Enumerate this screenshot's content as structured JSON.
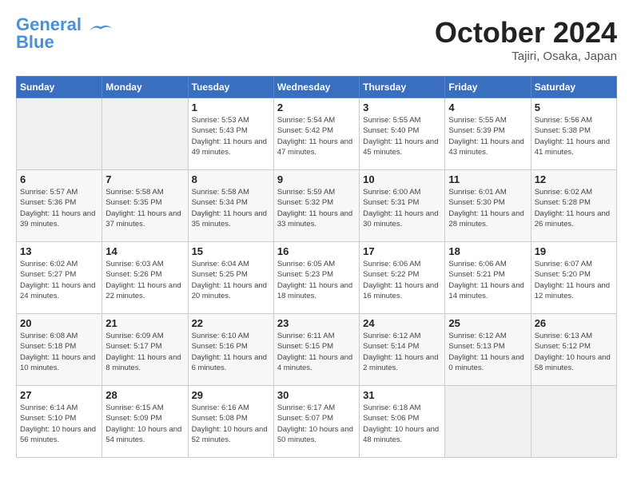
{
  "header": {
    "logo_line1": "General",
    "logo_line2": "Blue",
    "month_title": "October 2024",
    "location": "Tajiri, Osaka, Japan"
  },
  "weekdays": [
    "Sunday",
    "Monday",
    "Tuesday",
    "Wednesday",
    "Thursday",
    "Friday",
    "Saturday"
  ],
  "weeks": [
    [
      {
        "day": "",
        "info": ""
      },
      {
        "day": "",
        "info": ""
      },
      {
        "day": "1",
        "info": "Sunrise: 5:53 AM\nSunset: 5:43 PM\nDaylight: 11 hours and 49 minutes."
      },
      {
        "day": "2",
        "info": "Sunrise: 5:54 AM\nSunset: 5:42 PM\nDaylight: 11 hours and 47 minutes."
      },
      {
        "day": "3",
        "info": "Sunrise: 5:55 AM\nSunset: 5:40 PM\nDaylight: 11 hours and 45 minutes."
      },
      {
        "day": "4",
        "info": "Sunrise: 5:55 AM\nSunset: 5:39 PM\nDaylight: 11 hours and 43 minutes."
      },
      {
        "day": "5",
        "info": "Sunrise: 5:56 AM\nSunset: 5:38 PM\nDaylight: 11 hours and 41 minutes."
      }
    ],
    [
      {
        "day": "6",
        "info": "Sunrise: 5:57 AM\nSunset: 5:36 PM\nDaylight: 11 hours and 39 minutes."
      },
      {
        "day": "7",
        "info": "Sunrise: 5:58 AM\nSunset: 5:35 PM\nDaylight: 11 hours and 37 minutes."
      },
      {
        "day": "8",
        "info": "Sunrise: 5:58 AM\nSunset: 5:34 PM\nDaylight: 11 hours and 35 minutes."
      },
      {
        "day": "9",
        "info": "Sunrise: 5:59 AM\nSunset: 5:32 PM\nDaylight: 11 hours and 33 minutes."
      },
      {
        "day": "10",
        "info": "Sunrise: 6:00 AM\nSunset: 5:31 PM\nDaylight: 11 hours and 30 minutes."
      },
      {
        "day": "11",
        "info": "Sunrise: 6:01 AM\nSunset: 5:30 PM\nDaylight: 11 hours and 28 minutes."
      },
      {
        "day": "12",
        "info": "Sunrise: 6:02 AM\nSunset: 5:28 PM\nDaylight: 11 hours and 26 minutes."
      }
    ],
    [
      {
        "day": "13",
        "info": "Sunrise: 6:02 AM\nSunset: 5:27 PM\nDaylight: 11 hours and 24 minutes."
      },
      {
        "day": "14",
        "info": "Sunrise: 6:03 AM\nSunset: 5:26 PM\nDaylight: 11 hours and 22 minutes."
      },
      {
        "day": "15",
        "info": "Sunrise: 6:04 AM\nSunset: 5:25 PM\nDaylight: 11 hours and 20 minutes."
      },
      {
        "day": "16",
        "info": "Sunrise: 6:05 AM\nSunset: 5:23 PM\nDaylight: 11 hours and 18 minutes."
      },
      {
        "day": "17",
        "info": "Sunrise: 6:06 AM\nSunset: 5:22 PM\nDaylight: 11 hours and 16 minutes."
      },
      {
        "day": "18",
        "info": "Sunrise: 6:06 AM\nSunset: 5:21 PM\nDaylight: 11 hours and 14 minutes."
      },
      {
        "day": "19",
        "info": "Sunrise: 6:07 AM\nSunset: 5:20 PM\nDaylight: 11 hours and 12 minutes."
      }
    ],
    [
      {
        "day": "20",
        "info": "Sunrise: 6:08 AM\nSunset: 5:18 PM\nDaylight: 11 hours and 10 minutes."
      },
      {
        "day": "21",
        "info": "Sunrise: 6:09 AM\nSunset: 5:17 PM\nDaylight: 11 hours and 8 minutes."
      },
      {
        "day": "22",
        "info": "Sunrise: 6:10 AM\nSunset: 5:16 PM\nDaylight: 11 hours and 6 minutes."
      },
      {
        "day": "23",
        "info": "Sunrise: 6:11 AM\nSunset: 5:15 PM\nDaylight: 11 hours and 4 minutes."
      },
      {
        "day": "24",
        "info": "Sunrise: 6:12 AM\nSunset: 5:14 PM\nDaylight: 11 hours and 2 minutes."
      },
      {
        "day": "25",
        "info": "Sunrise: 6:12 AM\nSunset: 5:13 PM\nDaylight: 11 hours and 0 minutes."
      },
      {
        "day": "26",
        "info": "Sunrise: 6:13 AM\nSunset: 5:12 PM\nDaylight: 10 hours and 58 minutes."
      }
    ],
    [
      {
        "day": "27",
        "info": "Sunrise: 6:14 AM\nSunset: 5:10 PM\nDaylight: 10 hours and 56 minutes."
      },
      {
        "day": "28",
        "info": "Sunrise: 6:15 AM\nSunset: 5:09 PM\nDaylight: 10 hours and 54 minutes."
      },
      {
        "day": "29",
        "info": "Sunrise: 6:16 AM\nSunset: 5:08 PM\nDaylight: 10 hours and 52 minutes."
      },
      {
        "day": "30",
        "info": "Sunrise: 6:17 AM\nSunset: 5:07 PM\nDaylight: 10 hours and 50 minutes."
      },
      {
        "day": "31",
        "info": "Sunrise: 6:18 AM\nSunset: 5:06 PM\nDaylight: 10 hours and 48 minutes."
      },
      {
        "day": "",
        "info": ""
      },
      {
        "day": "",
        "info": ""
      }
    ]
  ]
}
